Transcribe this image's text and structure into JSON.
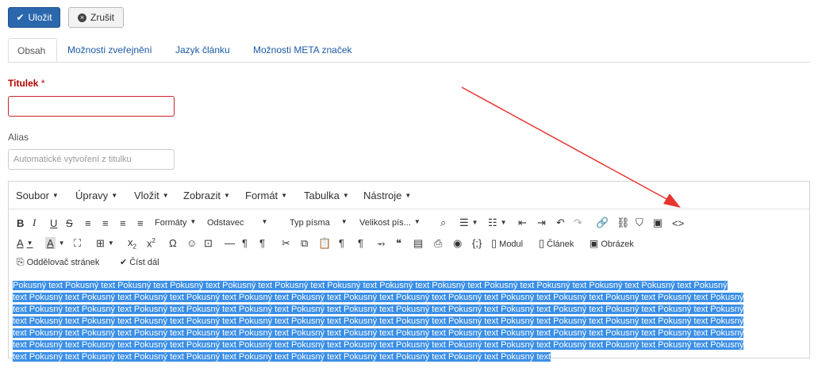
{
  "toolbar": {
    "save_label": "Uložit",
    "cancel_label": "Zrušit"
  },
  "tabs": [
    "Obsah",
    "Možnosti zveřejnění",
    "Jazyk článku",
    "Možnosti META značek"
  ],
  "form": {
    "title_label": "Titulek",
    "required_marker": "*",
    "alias_label": "Alias",
    "alias_placeholder": "Automatické vytvoření z titulku"
  },
  "editor": {
    "menus": [
      "Soubor",
      "Úpravy",
      "Vložit",
      "Zobrazit",
      "Formát",
      "Tabulka",
      "Nástroje"
    ],
    "formats_label": "Formáty",
    "block_label": "Odstavec",
    "font_label": "Typ písma",
    "size_label": "Velikost pís...",
    "module_label": "Modul",
    "article_label": "Článek",
    "image_label": "Obrázek",
    "pagebreak_label": "Oddělovač stránek",
    "readmore_label": "Číst dál",
    "content_lines": [
      "Pokusný text Pokusný text Pokusný text Pokusný text Pokusný text Pokusný text Pokusný text Pokusný text Pokusný text Pokusný text Pokusný text Pokusný text Pokusný text Pokusný",
      "text Pokusný text Pokusný text Pokusný text Pokusný text Pokusný text Pokusný text Pokusný text Pokusný text Pokusný text Pokusný text Pokusný text Pokusný text Pokusný text Pokusný",
      "text Pokusný text Pokusný text Pokusný text Pokusný text Pokusný text Pokusný text Pokusný text Pokusný text Pokusný text Pokusný text Pokusný text Pokusný text Pokusný text Pokusný",
      "text Pokusný text Pokusný text Pokusný text Pokusný text Pokusný text Pokusný text Pokusný text Pokusný text Pokusný text Pokusný text Pokusný text Pokusný text Pokusný text Pokusný",
      "text Pokusný text Pokusný text Pokusný text Pokusný text Pokusný text Pokusný text Pokusný text Pokusný text Pokusný text Pokusný text Pokusný text Pokusný text Pokusný text Pokusný",
      "text Pokusný text Pokusný text Pokusný text Pokusný text Pokusný text Pokusný text Pokusný text Pokusný text Pokusný text Pokusný text Pokusný text Pokusný text Pokusný text Pokusný",
      "text Pokusný text Pokusný text Pokusný text Pokusný text Pokusný text Pokusný text Pokusný text Pokusný text Pokusný text Pokusný text"
    ]
  },
  "colors": {
    "primary": "#2a67ad",
    "link": "#1c5aa6",
    "required": "#b30000",
    "selection": "#3b8fe6",
    "annotation_arrow": "#e8342e"
  }
}
